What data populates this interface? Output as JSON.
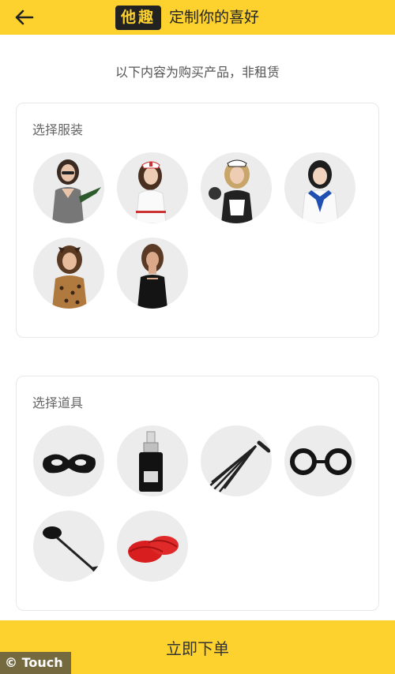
{
  "header": {
    "logo_text": "他趣",
    "title": "定制你的喜好"
  },
  "notice": "以下内容为购买产品，非租赁",
  "costume_section": {
    "title": "选择服装",
    "items": [
      {
        "icon": "costume-secretary"
      },
      {
        "icon": "costume-nurse"
      },
      {
        "icon": "costume-maid"
      },
      {
        "icon": "costume-schoolgirl"
      },
      {
        "icon": "costume-leopard"
      },
      {
        "icon": "costume-black-dress"
      }
    ]
  },
  "props_section": {
    "title": "选择道具",
    "items": [
      {
        "icon": "mask-icon"
      },
      {
        "icon": "bottle-icon"
      },
      {
        "icon": "whip-icon"
      },
      {
        "icon": "handcuffs-icon"
      },
      {
        "icon": "feather-tickler-icon"
      },
      {
        "icon": "red-rope-icon"
      }
    ]
  },
  "footer": {
    "order_label": "立即下单"
  },
  "watermark": "© Touch",
  "colors": {
    "accent": "#fdd22f",
    "logo_bg": "#222222",
    "circle_bg": "#ececec"
  }
}
